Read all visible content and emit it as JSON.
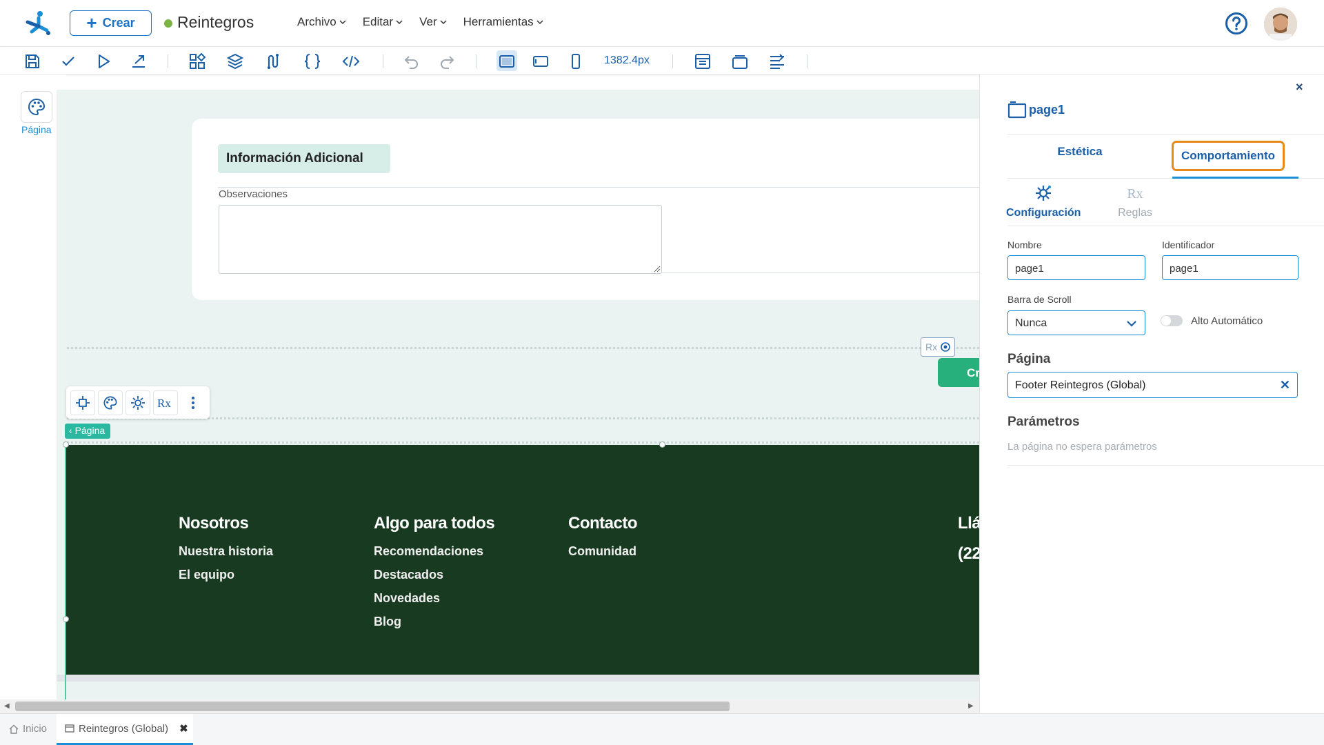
{
  "header": {
    "create_label": "Crear",
    "app_title": "Reintegros",
    "menu": [
      "Archivo",
      "Editar",
      "Ver",
      "Herramientas"
    ]
  },
  "toolbar": {
    "size_text": "1382.4px"
  },
  "left_rail": {
    "label": "Página"
  },
  "canvas": {
    "section_title": "Información Adicional",
    "field_label": "Observaciones",
    "rx_label": "Rx",
    "green_button_label": "Cr",
    "page_tag": "Página"
  },
  "footer_preview": {
    "columns": [
      {
        "heading": "Nosotros",
        "links": [
          "Nuestra historia",
          "El equipo"
        ]
      },
      {
        "heading": "Algo para todos",
        "links": [
          "Recomendaciones",
          "Destacados",
          "Novedades",
          "Blog"
        ]
      },
      {
        "heading": "Contacto",
        "links": [
          "Comunidad"
        ]
      },
      {
        "heading": "Llá",
        "links": [
          "(22"
        ]
      }
    ]
  },
  "tabs": {
    "home": "Inicio",
    "active": "Reintegros (Global)"
  },
  "panel": {
    "title": "page1",
    "tabs": [
      "Estética",
      "Comportamiento"
    ],
    "subtabs": [
      "Configuración",
      "Reglas"
    ],
    "subtab_rules_icon": "Rx",
    "nombre_label": "Nombre",
    "nombre_value": "page1",
    "id_label": "Identificador",
    "id_value": "page1",
    "scroll_label": "Barra de Scroll",
    "scroll_value": "Nunca",
    "auto_height_label": "Alto Automático",
    "pagina_title": "Página",
    "pagina_value": "Footer Reintegros (Global)",
    "params_title": "Parámetros",
    "params_empty": "La página no espera parámetros"
  },
  "colors": {
    "accent": "#1a5fa8",
    "highlight": "#e88a1a",
    "footer_bg": "#183a20",
    "status_dot": "#7cb342"
  }
}
